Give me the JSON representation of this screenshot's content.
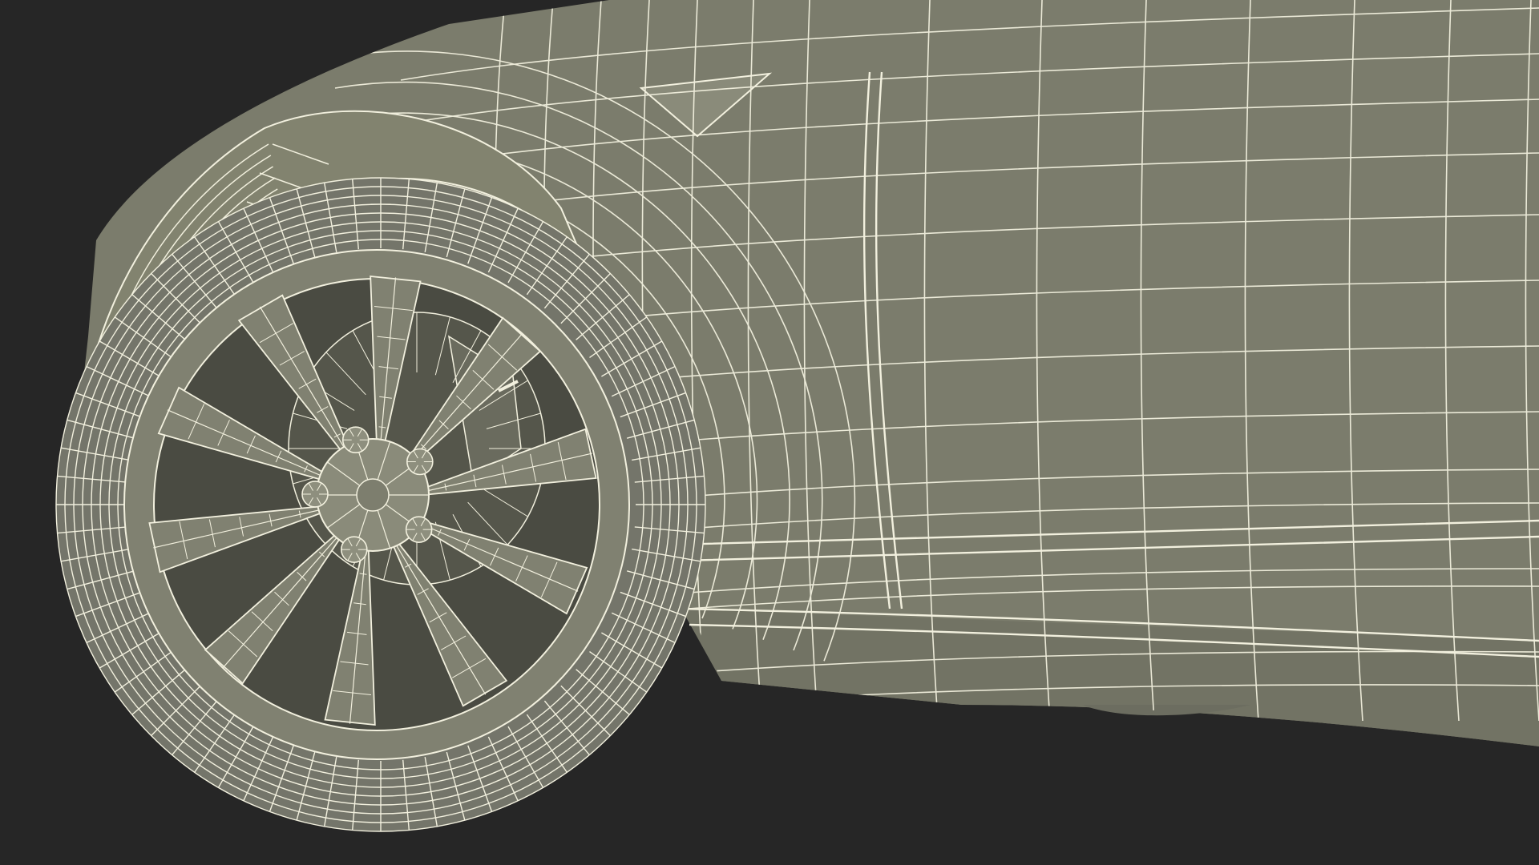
{
  "scene": {
    "subject": "car-front-wheel-wireframe",
    "colors": {
      "background": "#262626",
      "body_fill": "#7b7c6c",
      "body_shadow": "#5f6053",
      "wheel_well": "#3e3f37",
      "tire_fill": "#74756a",
      "rim_fill": "#808171",
      "rim_dark": "#4a4b42",
      "wire": "#f2f0de"
    },
    "wheel": {
      "spoke_count": 10,
      "lug_nut_count": 5
    }
  }
}
